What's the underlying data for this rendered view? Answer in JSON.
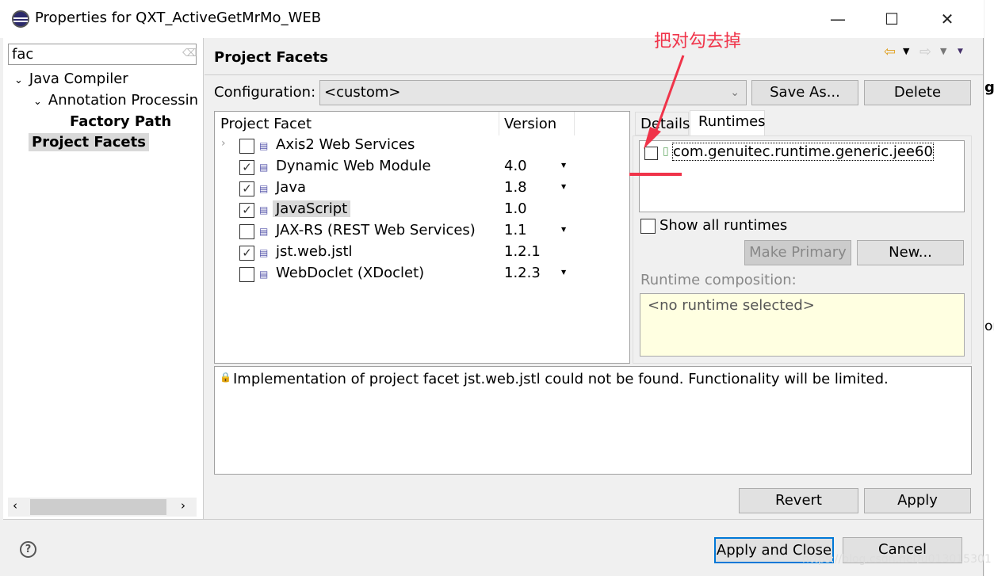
{
  "window": {
    "title": "Properties for QXT_ActiveGetMrMo_WEB",
    "minimize": "—",
    "maximize": "☐",
    "close": "✕"
  },
  "sidebar": {
    "filter": "fac",
    "items": [
      {
        "label": "Java Compiler"
      },
      {
        "label": "Annotation Processin"
      },
      {
        "label": "Factory Path"
      },
      {
        "label": "Project Facets"
      }
    ]
  },
  "page": {
    "title": "Project Facets",
    "configuration_label": "Configuration:",
    "configuration_value": "<custom>",
    "save_as": "Save As...",
    "delete": "Delete"
  },
  "facets": {
    "col_facet": "Project Facet",
    "col_version": "Version",
    "rows": [
      {
        "name": "Axis2 Web Services",
        "checked": false,
        "version": "",
        "dropdown": false,
        "expandable": true
      },
      {
        "name": "Dynamic Web Module",
        "checked": true,
        "version": "4.0",
        "dropdown": true
      },
      {
        "name": "Java",
        "checked": true,
        "version": "1.8",
        "dropdown": true
      },
      {
        "name": "JavaScript",
        "checked": true,
        "version": "1.0",
        "dropdown": false,
        "selected": true
      },
      {
        "name": "JAX-RS (REST Web Services)",
        "checked": false,
        "version": "1.1",
        "dropdown": true
      },
      {
        "name": "jst.web.jstl",
        "checked": true,
        "version": "1.2.1",
        "dropdown": false
      },
      {
        "name": "WebDoclet (XDoclet)",
        "checked": false,
        "version": "1.2.3",
        "dropdown": true
      }
    ]
  },
  "runtimes": {
    "tab_details": "Details",
    "tab_runtimes": "Runtimes",
    "runtime_item": "com.genuitec.runtime.generic.jee60",
    "show_all": "Show all runtimes",
    "make_primary": "Make Primary",
    "new": "New...",
    "composition_label": "Runtime composition:",
    "composition_value": "<no runtime selected>"
  },
  "message": "Implementation of project facet jst.web.jstl could not be found. Functionality will be limited.",
  "buttons": {
    "revert": "Revert",
    "apply": "Apply",
    "apply_close": "Apply and Close",
    "cancel": "Cancel"
  },
  "annotation": {
    "text": "把对勾去掉",
    "color": "#f0344a"
  },
  "background_text": {
    "top": "ge",
    "mid": "on"
  },
  "watermark": "https://blog.csdn.net/u013015301"
}
